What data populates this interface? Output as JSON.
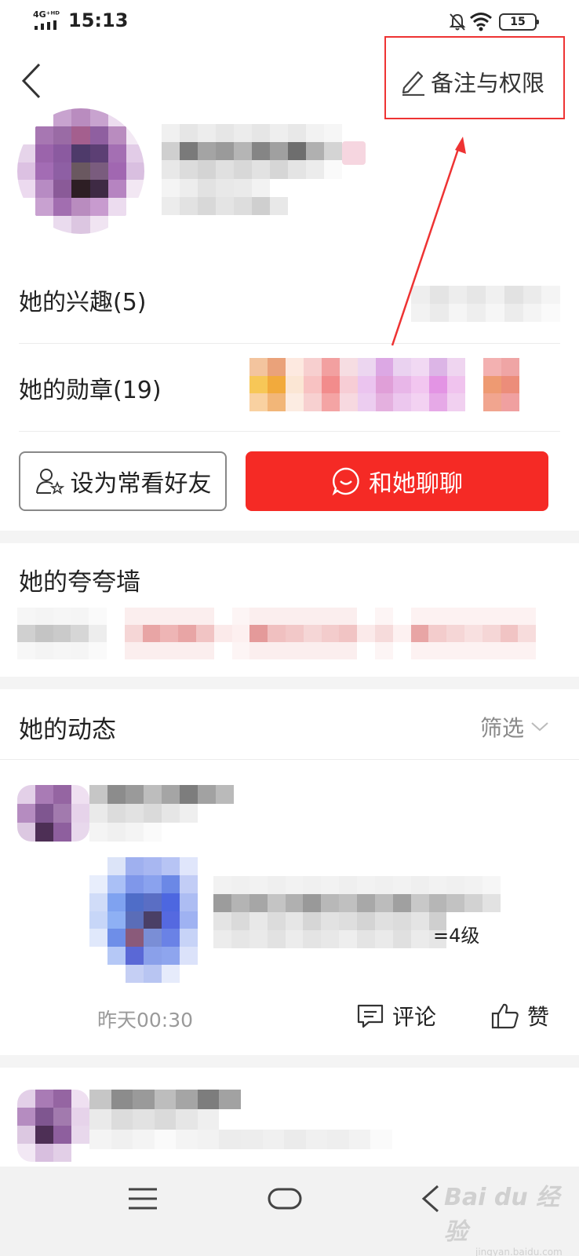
{
  "status_bar": {
    "network": "4G⁺ᴴᴰ",
    "time": "15:13",
    "battery": "15"
  },
  "header": {
    "remark_button_label": "备注与权限"
  },
  "profile": {
    "interests_label": "她的兴趣(5)",
    "badges_label": "她的勋章(19)",
    "fav_button_label": "设为常看好友",
    "chat_button_label": "和她聊聊"
  },
  "praise_wall": {
    "title": "她的夸夸墙"
  },
  "feed": {
    "title": "她的动态",
    "filter_label": "筛选",
    "posts": [
      {
        "level_fragment": "=4级",
        "time": "昨天00:30",
        "comment_label": "评论",
        "like_label": "赞"
      }
    ]
  },
  "watermark": {
    "text": "Bai du 经验",
    "url": "jingyan.baidu.com"
  },
  "icons": [
    "back-icon",
    "pencil-icon",
    "add-friend-icon",
    "chat-bubble-icon",
    "chevron-down-icon",
    "comment-icon",
    "thumbs-up-icon",
    "menu-icon",
    "home-icon",
    "back-nav-icon",
    "mute-icon",
    "wifi-icon"
  ],
  "colors": {
    "accent_red": "#f52a25",
    "highlight_red": "#e33333"
  }
}
